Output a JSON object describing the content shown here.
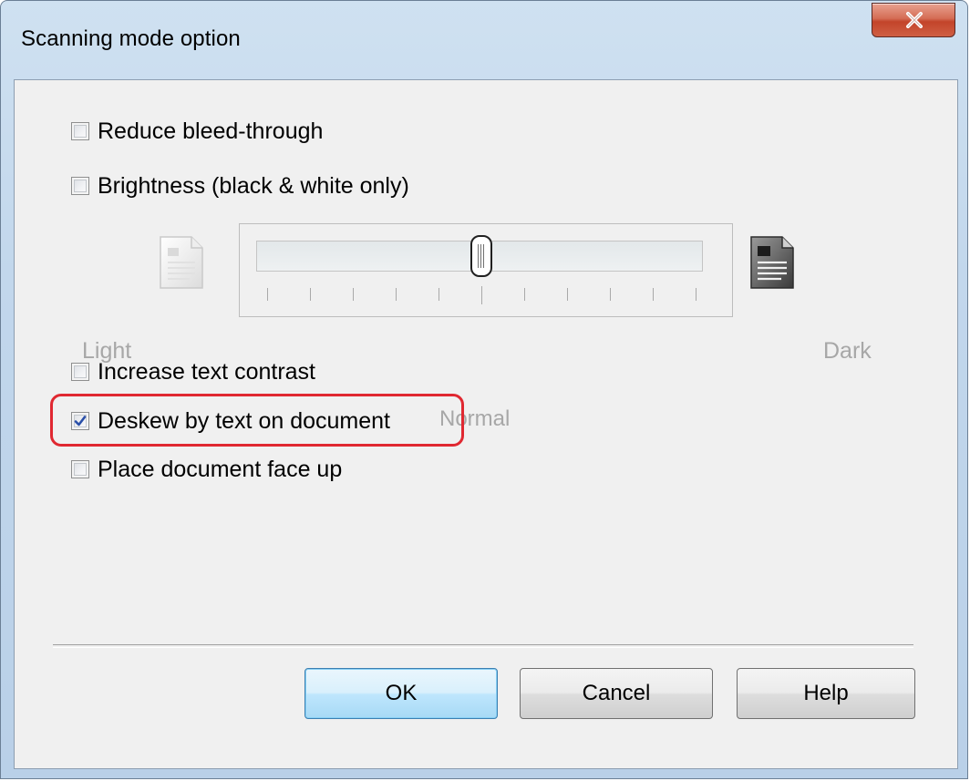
{
  "window": {
    "title": "Scanning mode option",
    "close_icon": "close-x-icon"
  },
  "options": {
    "reduce_bleed": {
      "label": "Reduce bleed-through",
      "checked": false,
      "enabled": true
    },
    "brightness": {
      "label": "Brightness (black & white only)",
      "checked": false,
      "enabled": true
    },
    "increase_contrast": {
      "label": "Increase text contrast",
      "checked": false,
      "enabled": true
    },
    "deskew": {
      "label": "Deskew by text on document",
      "checked": true,
      "enabled": true
    },
    "face_up": {
      "label": "Place document face up",
      "checked": false,
      "enabled": true
    }
  },
  "brightness_slider": {
    "enabled": false,
    "min_label": "Light",
    "max_label": "Dark",
    "center_label": "Normal",
    "min_icon": "light-document-icon",
    "max_icon": "dark-document-icon",
    "tick_count": 11,
    "value": 0.5
  },
  "buttons": {
    "ok": "OK",
    "cancel": "Cancel",
    "help": "Help"
  },
  "colors": {
    "highlight": "#e02831",
    "default_button": "#3c7fb1",
    "check_mark": "#2a4fa8"
  }
}
